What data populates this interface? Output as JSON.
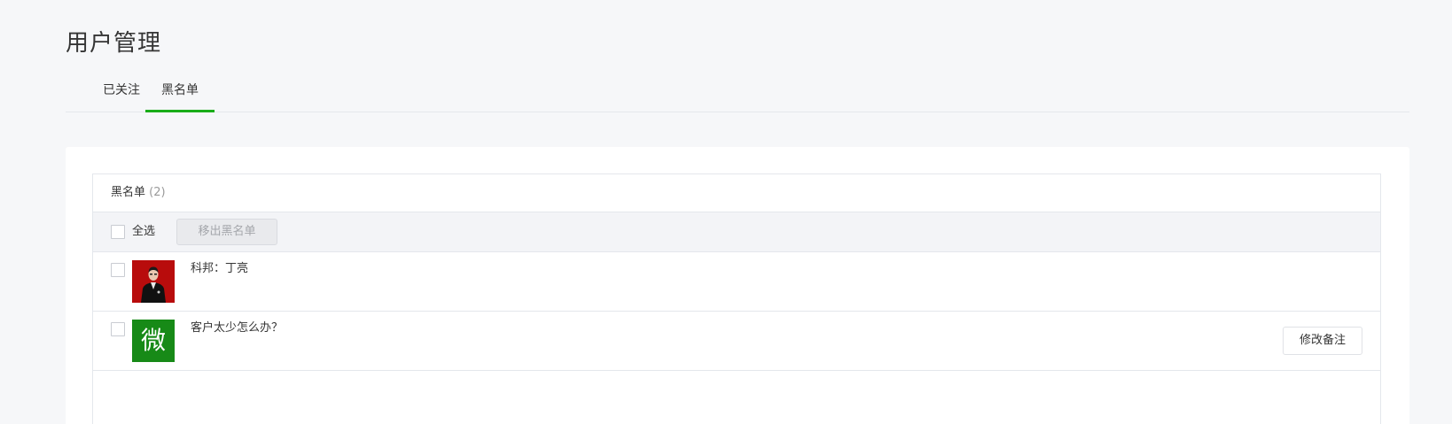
{
  "page": {
    "title": "用户管理"
  },
  "tabs": [
    {
      "label": "已关注",
      "active": false
    },
    {
      "label": "黑名单",
      "active": true
    }
  ],
  "blacklist": {
    "title": "黑名单",
    "count": "(2)",
    "select_all_label": "全选",
    "remove_button_label": "移出黑名单",
    "users": [
      {
        "name": "科邦：丁亮",
        "avatar": "person-photo"
      },
      {
        "name": "客户太少怎么办？",
        "avatar": "wechat-icon",
        "avatar_char": "微",
        "action_label": "修改备注"
      }
    ]
  },
  "colors": {
    "accent": "#1aad19",
    "background": "#f6f7f9",
    "avatar_red": "#b80c0c",
    "avatar_green": "#178a17"
  }
}
